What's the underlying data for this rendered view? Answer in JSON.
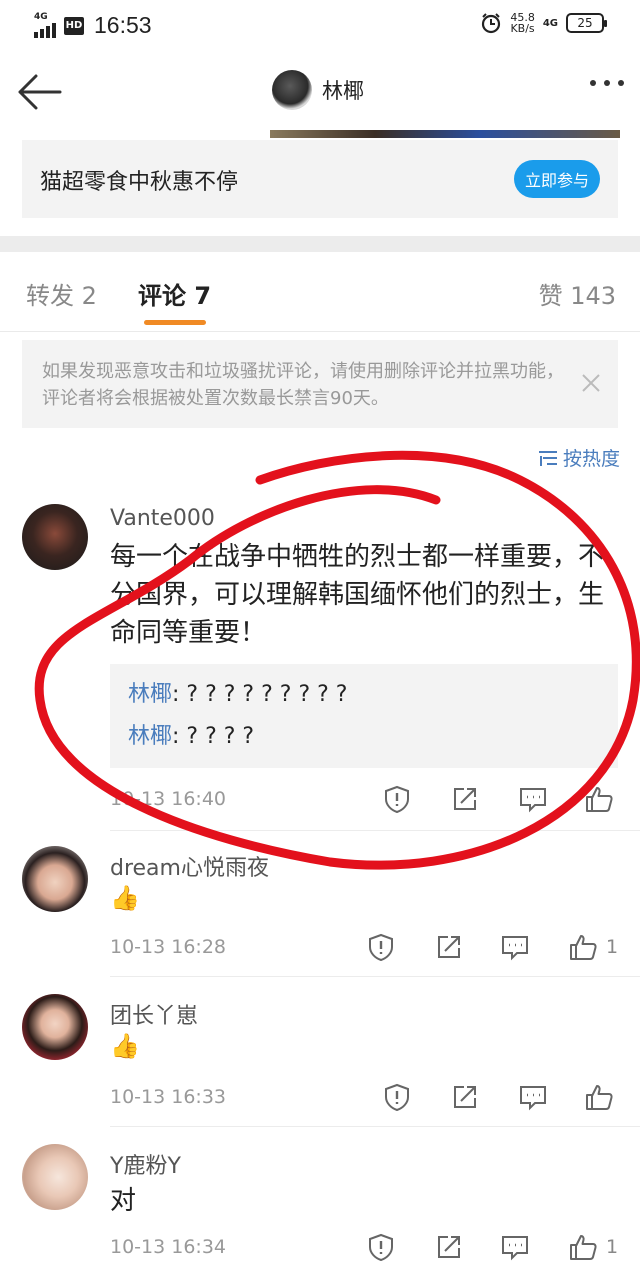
{
  "status_bar": {
    "network_left": "4G",
    "hd": "HD",
    "time": "16:53",
    "speed_value": "45.8",
    "speed_unit": "KB/s",
    "network_right": "4G",
    "battery": "25"
  },
  "nav": {
    "title": "林椰"
  },
  "promo": {
    "text": "猫超零食中秋惠不停",
    "button": "立即参与"
  },
  "tabs": {
    "repost": "转发 2",
    "comment": "评论 7",
    "like": "赞 143"
  },
  "notice": {
    "text": "如果发现恶意攻击和垃圾骚扰评论，请使用删除评论并拉黑功能，评论者将会根据被处置次数最长禁言90天。"
  },
  "sort": {
    "label": "按热度"
  },
  "comments": [
    {
      "name": "Vante000",
      "body": "每一个在战争中牺牲的烈士都一样重要，不分国界，可以理解韩国缅怀他们的烈士，生命同等重要！",
      "replies": [
        {
          "who": "林椰",
          "text": ": ? ? ? ? ? ? ? ? ?"
        },
        {
          "who": "林椰",
          "text": ": ? ? ? ?"
        }
      ],
      "time": "10-13 16:40",
      "likes": ""
    },
    {
      "name": "dream心悦雨夜",
      "body": "👍",
      "time": "10-13 16:28",
      "likes": "1"
    },
    {
      "name": "团长丫崽",
      "body": "👍",
      "time": "10-13 16:33",
      "likes": ""
    },
    {
      "name": "Y鹿粉Y",
      "body": "对",
      "time": "10-13 16:34",
      "likes": "1"
    }
  ],
  "colors": {
    "accent_orange": "#f08a24",
    "link_blue": "#4a7dbd",
    "button_blue": "#1a9ceb",
    "annotation_red": "#e3111c"
  }
}
